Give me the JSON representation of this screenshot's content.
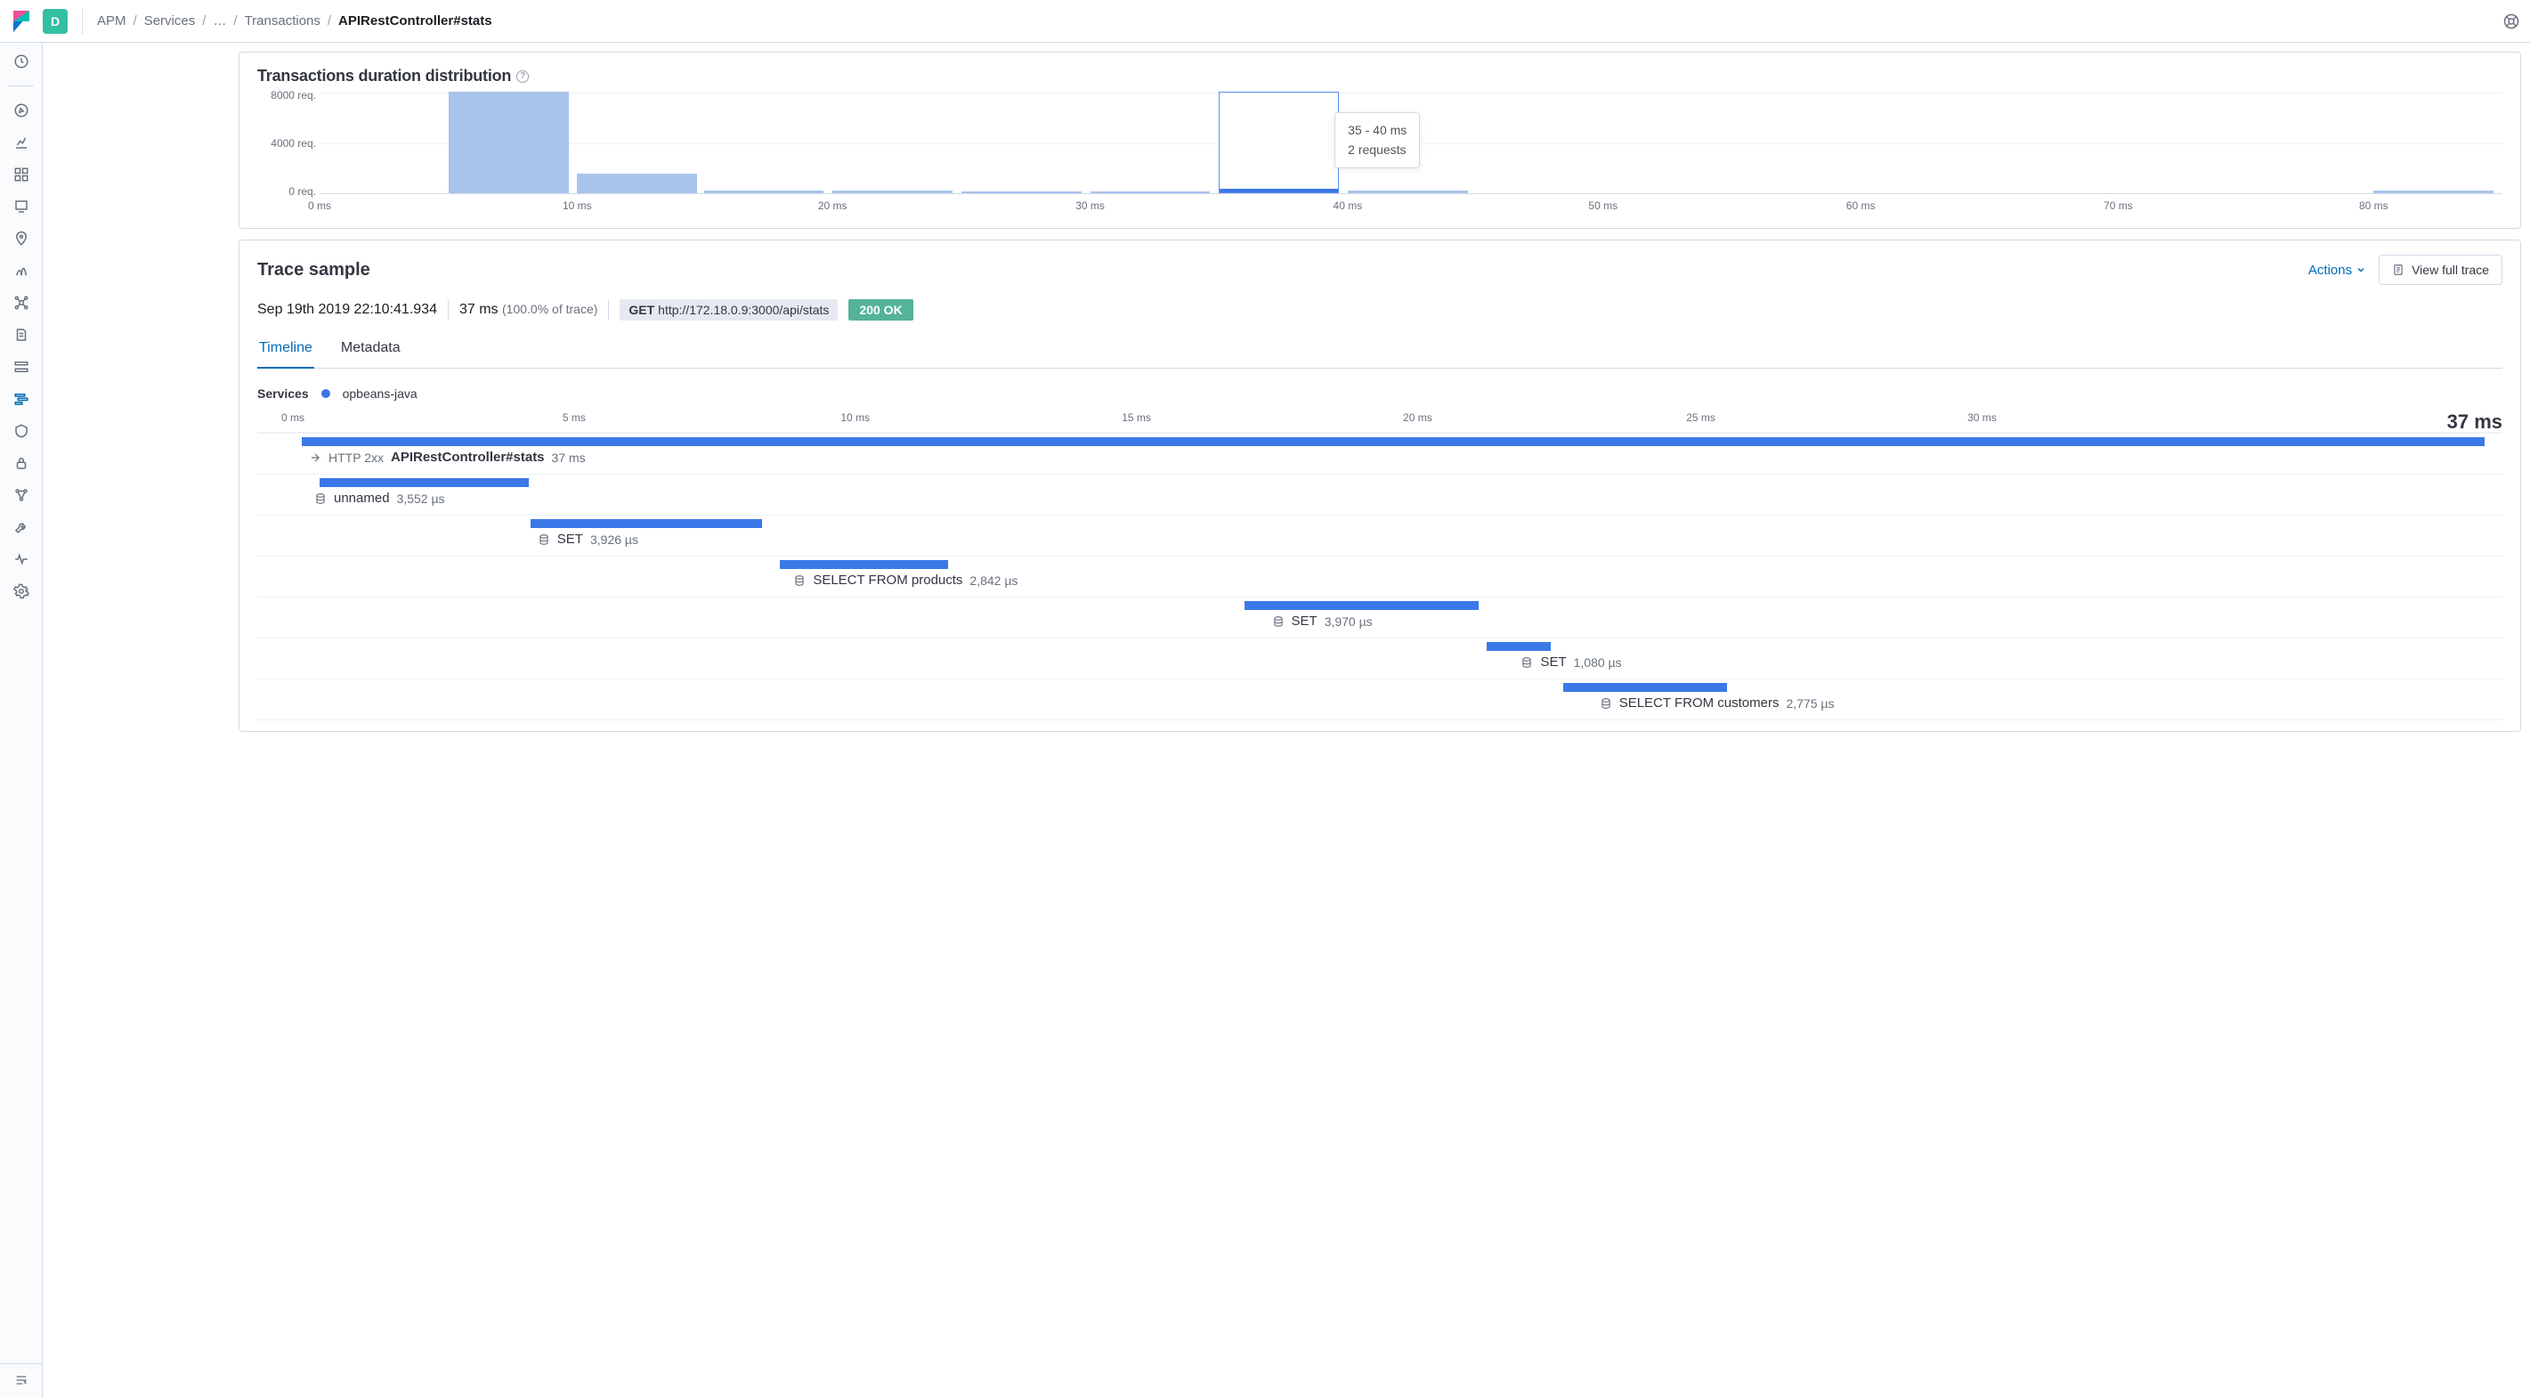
{
  "space_letter": "D",
  "breadcrumbs": {
    "apm": "APM",
    "services": "Services",
    "ellipsis": "…",
    "transactions": "Transactions",
    "current": "APIRestController#stats"
  },
  "help_icon": "lifebuoy",
  "histogram": {
    "title": "Transactions duration distribution",
    "y_labels": [
      "8000 req.",
      "4000 req.",
      "0 req."
    ],
    "x_labels": [
      "0 ms",
      "10 ms",
      "20 ms",
      "30 ms",
      "40 ms",
      "50 ms",
      "60 ms",
      "70 ms",
      "80 ms"
    ],
    "tooltip": {
      "range": "35 - 40 ms",
      "count": "2 requests"
    }
  },
  "chart_data": {
    "type": "bar",
    "title": "Transactions duration distribution",
    "xlabel": "ms",
    "ylabel": "req.",
    "xlim": [
      0,
      85
    ],
    "ylim": [
      0,
      8000
    ],
    "bins_ms": [
      5,
      10,
      15,
      20,
      25,
      30,
      35,
      40,
      45,
      80
    ],
    "counts": [
      8000,
      1500,
      120,
      100,
      60,
      60,
      2,
      10,
      10,
      10
    ],
    "selected_bin": {
      "range_ms": [
        35,
        40
      ],
      "count": 2
    }
  },
  "trace": {
    "title": "Trace sample",
    "actions_label": "Actions",
    "view_full_label": "View full trace",
    "timestamp": "Sep 19th 2019 22:10:41.934",
    "duration": "37 ms",
    "duration_pct": "(100.0% of trace)",
    "http": {
      "method": "GET",
      "url": "http://172.18.0.9:3000/api/stats"
    },
    "status": "200 OK",
    "tabs": {
      "timeline": "Timeline",
      "metadata": "Metadata"
    },
    "services_label": "Services",
    "service_name": "opbeans-java",
    "timeline": {
      "ticks": [
        "0 ms",
        "5 ms",
        "10 ms",
        "15 ms",
        "20 ms",
        "25 ms",
        "30 ms"
      ],
      "total": "37 ms"
    }
  },
  "spans": {
    "root": {
      "status": "HTTP 2xx",
      "name": "APIRestController#stats",
      "dur": "37 ms"
    },
    "s1": {
      "name": "unnamed",
      "dur": "3,552 µs"
    },
    "s2": {
      "name": "SET",
      "dur": "3,926 µs"
    },
    "s3": {
      "name": "SELECT FROM products",
      "dur": "2,842 µs"
    },
    "s4": {
      "name": "SET",
      "dur": "3,970 µs"
    },
    "s5": {
      "name": "SET",
      "dur": "1,080 µs"
    },
    "s6": {
      "name": "SELECT FROM customers",
      "dur": "2,775 µs"
    }
  },
  "waterfall_data": {
    "total_ms": 37,
    "spans": [
      {
        "id": "root",
        "offset_ms": 0,
        "duration_ms": 37,
        "name": "APIRestController#stats",
        "type": "http",
        "status": "HTTP 2xx"
      },
      {
        "id": "s1",
        "offset_ms": 0.3,
        "duration_us": 3552,
        "name": "unnamed",
        "type": "db"
      },
      {
        "id": "s2",
        "offset_ms": 3.9,
        "duration_us": 3926,
        "name": "SET",
        "type": "db"
      },
      {
        "id": "s3",
        "offset_ms": 8.1,
        "duration_us": 2842,
        "name": "SELECT FROM products",
        "type": "db"
      },
      {
        "id": "s4",
        "offset_ms": 16.0,
        "duration_us": 3970,
        "name": "SET",
        "type": "db"
      },
      {
        "id": "s5",
        "offset_ms": 20.1,
        "duration_us": 1080,
        "name": "SET",
        "type": "db"
      },
      {
        "id": "s6",
        "offset_ms": 21.4,
        "duration_us": 2775,
        "name": "SELECT FROM customers",
        "type": "db"
      }
    ]
  }
}
